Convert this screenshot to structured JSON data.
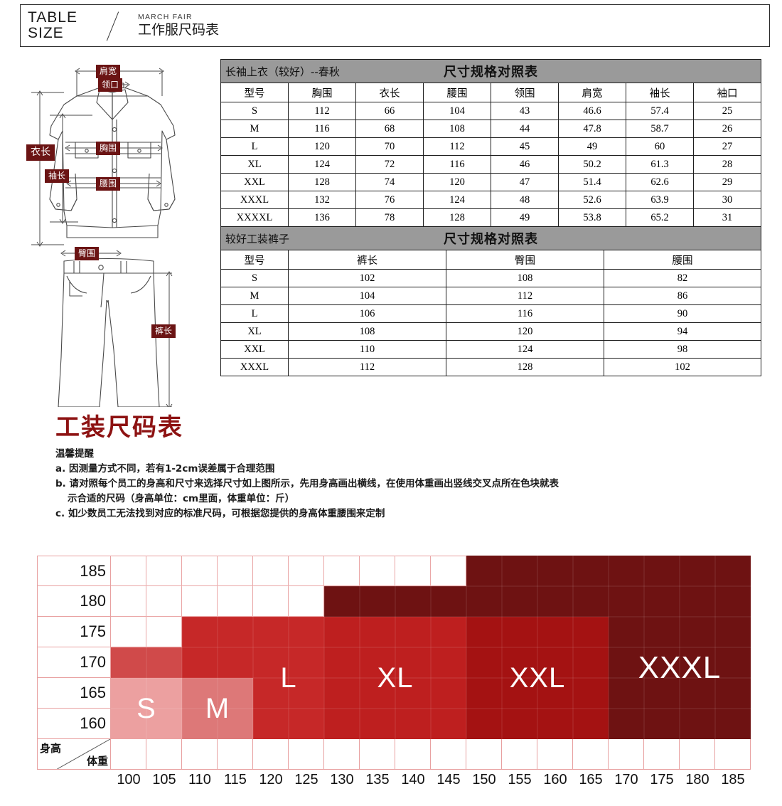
{
  "header": {
    "line1": "TABLE",
    "line2": "SIZE",
    "brand_en": "MARCH FAIR",
    "brand_cn": "工作服尺码表",
    "divider_icon": "slash-divider-icon"
  },
  "illustration": {
    "jacket_icon": "jacket-outline-icon",
    "pants_icon": "pants-outline-icon",
    "labels": {
      "shoulder": "肩宽",
      "collar": "领口",
      "bust": "胸围",
      "length": "衣长",
      "sleeve": "袖长",
      "waist": "腰围",
      "hip": "臀围",
      "pants_length": "裤长"
    }
  },
  "top_table": {
    "band_left": "长袖上衣（较好）--春秋",
    "band_center": "尺寸规格对照表",
    "columns": [
      "型号",
      "胸围",
      "衣长",
      "腰围",
      "领围",
      "肩宽",
      "袖长",
      "袖口"
    ],
    "rows": [
      [
        "S",
        "112",
        "66",
        "104",
        "43",
        "46.6",
        "57.4",
        "25"
      ],
      [
        "M",
        "116",
        "68",
        "108",
        "44",
        "47.8",
        "58.7",
        "26"
      ],
      [
        "L",
        "120",
        "70",
        "112",
        "45",
        "49",
        "60",
        "27"
      ],
      [
        "XL",
        "124",
        "72",
        "116",
        "46",
        "50.2",
        "61.3",
        "28"
      ],
      [
        "XXL",
        "128",
        "74",
        "120",
        "47",
        "51.4",
        "62.6",
        "29"
      ],
      [
        "XXXL",
        "132",
        "76",
        "124",
        "48",
        "52.6",
        "63.9",
        "30"
      ],
      [
        "XXXXL",
        "136",
        "78",
        "128",
        "49",
        "53.8",
        "65.2",
        "31"
      ]
    ]
  },
  "bottom_table": {
    "band_left": "较好工装裤子",
    "band_center": "尺寸规格对照表",
    "columns": [
      "型号",
      "裤长",
      "臀围",
      "腰围"
    ],
    "rows": [
      [
        "S",
        "102",
        "108",
        "82"
      ],
      [
        "M",
        "104",
        "112",
        "86"
      ],
      [
        "L",
        "106",
        "116",
        "90"
      ],
      [
        "XL",
        "108",
        "120",
        "94"
      ],
      [
        "XXL",
        "110",
        "124",
        "98"
      ],
      [
        "XXXL",
        "112",
        "128",
        "102"
      ]
    ]
  },
  "notes": {
    "title": "工装尺码表",
    "heading": "温馨提醒",
    "a": "a. 因测量方式不同，若有1-2cm误差属于合理范围",
    "b1": "b. 请对照每个员工的身高和尺寸来选择尺寸如上图所示，先用身高画出横线，在使用体重画出竖线交叉点所在色块就表",
    "b2": "示合适的尺码（身高单位：cm里面，体重单位：斤）",
    "c": "c. 如少数员工无法找到对应的标准尺码，可根据您提供的身高体重腰围来定制"
  },
  "chart_data": {
    "type": "heatmap",
    "title": "工装尺码表",
    "xlabel": "体重",
    "ylabel": "身高",
    "x_unit": "斤",
    "y_unit": "cm",
    "grid": true,
    "legend_position": "in-cell labels",
    "x": [
      "100",
      "105",
      "110",
      "115",
      "120",
      "125",
      "130",
      "135",
      "140",
      "145",
      "150",
      "155",
      "160",
      "165",
      "170",
      "175",
      "180",
      "185"
    ],
    "y": [
      "185",
      "180",
      "175",
      "170",
      "165",
      "160"
    ],
    "corner_label_row": "身高",
    "corner_label_col": "体重",
    "grid_line_color": "#e8a0a0",
    "size_colors": {
      "S": "#ECA0A0",
      "M": "#DD7878",
      "L": "#C62828",
      "XL": "#B51818",
      "XXL": "#A41212",
      "XXXL": "#6E1212"
    },
    "regions": [
      {
        "size": "S",
        "color": "#ECA0A0",
        "x_from": "100",
        "x_to": "110",
        "y_from": "160",
        "y_to": "165"
      },
      {
        "size": "S2",
        "color": "#DD7878",
        "x_from": "100",
        "x_to": "110",
        "y_from": "170",
        "y_to": "170"
      },
      {
        "size": "M",
        "color": "#DD7878",
        "x_from": "110",
        "x_to": "120",
        "y_from": "160",
        "y_to": "165"
      },
      {
        "size": "M2",
        "color": "#C62828",
        "x_from": "110",
        "x_to": "120",
        "y_from": "170",
        "y_to": "175"
      },
      {
        "size": "L",
        "color": "#C62828",
        "x_from": "120",
        "x_to": "130",
        "y_from": "160",
        "y_to": "175"
      },
      {
        "size": "XL",
        "color": "#B51818",
        "x_from": "130",
        "x_to": "150",
        "y_from": "160",
        "y_to": "175"
      },
      {
        "size": "XL2",
        "color": "#6E1212",
        "x_from": "130",
        "x_to": "150",
        "y_from": "180",
        "y_to": "180"
      },
      {
        "size": "XXL",
        "color": "#A41212",
        "x_from": "150",
        "x_to": "170",
        "y_from": "160",
        "y_to": "175"
      },
      {
        "size": "XXL2",
        "color": "#6E1212",
        "x_from": "150",
        "x_to": "170",
        "y_from": "180",
        "y_to": "185"
      },
      {
        "size": "XXXL",
        "color": "#6E1212",
        "x_from": "170",
        "x_to": "185",
        "y_from": "160",
        "y_to": "185"
      }
    ],
    "labels": [
      {
        "text": "S",
        "x": "105",
        "y": "162"
      },
      {
        "text": "M",
        "x": "115",
        "y": "162"
      },
      {
        "text": "L",
        "x": "125",
        "y": "167"
      },
      {
        "text": "XL",
        "x": "140",
        "y": "170"
      },
      {
        "text": "XXL",
        "x": "160",
        "y": "170"
      },
      {
        "text": "XXXL",
        "x": "178",
        "y": "172"
      }
    ]
  }
}
